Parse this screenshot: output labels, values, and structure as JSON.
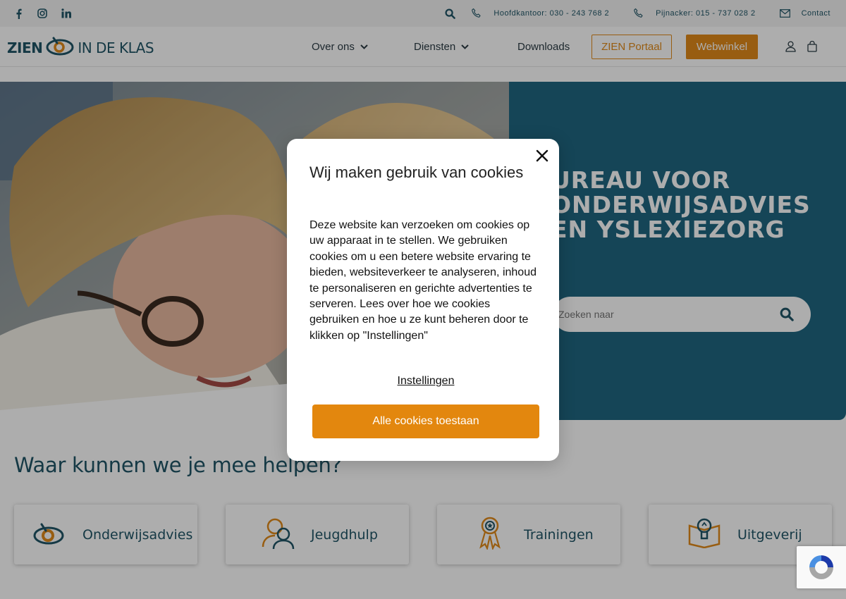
{
  "topbar": {
    "social": [
      "facebook-icon",
      "instagram-icon",
      "linkedin-icon"
    ],
    "hoofdkantoor": "Hoofdkantoor: 030 - 243 768 2",
    "pijnacker": "Pijnacker: 015 - 737 028 2",
    "contact": "Contact"
  },
  "nav": {
    "logo_left": "ZIEN",
    "logo_right": "IN DE KLAS",
    "items": [
      {
        "label": "Over ons"
      },
      {
        "label": "Diensten"
      },
      {
        "label": "Downloads"
      }
    ],
    "portal": "ZIEN Portaal",
    "shop": "Webwinkel"
  },
  "hero": {
    "title": "UREAU VOOR ONDERWIJSADVIES EN YSLEXIEZORG",
    "search_placeholder": "Zoeken naar"
  },
  "section": {
    "title": "Waar kunnen we je mee helpen?",
    "cards": [
      {
        "label": "Onderwijsadvies",
        "icon": "eye-logo-icon"
      },
      {
        "label": "Jeugdhulp",
        "icon": "people-icon"
      },
      {
        "label": "Trainingen",
        "icon": "award-ribbon-icon"
      },
      {
        "label": "Uitgeverij",
        "icon": "book-lightbulb-icon"
      }
    ]
  },
  "cookie_modal": {
    "title": "Wij maken gebruik van cookies",
    "body": "Deze website kan verzoeken om cookies op uw apparaat in te stellen. We gebruiken cookies om u een betere website ervaring te bieden, websiteverkeer te analyseren, inhoud te personaliseren en gerichte advertenties te serveren. Lees over hoe we cookies gebruiken en hoe u ze kunt beheren door te klikken op \"Instellingen\"",
    "settings": "Instellingen",
    "accept": "Alle cookies toestaan"
  },
  "colors": {
    "brand_teal": "#1f6680",
    "brand_orange": "#e08a1a",
    "text_teal": "#1f5566"
  }
}
